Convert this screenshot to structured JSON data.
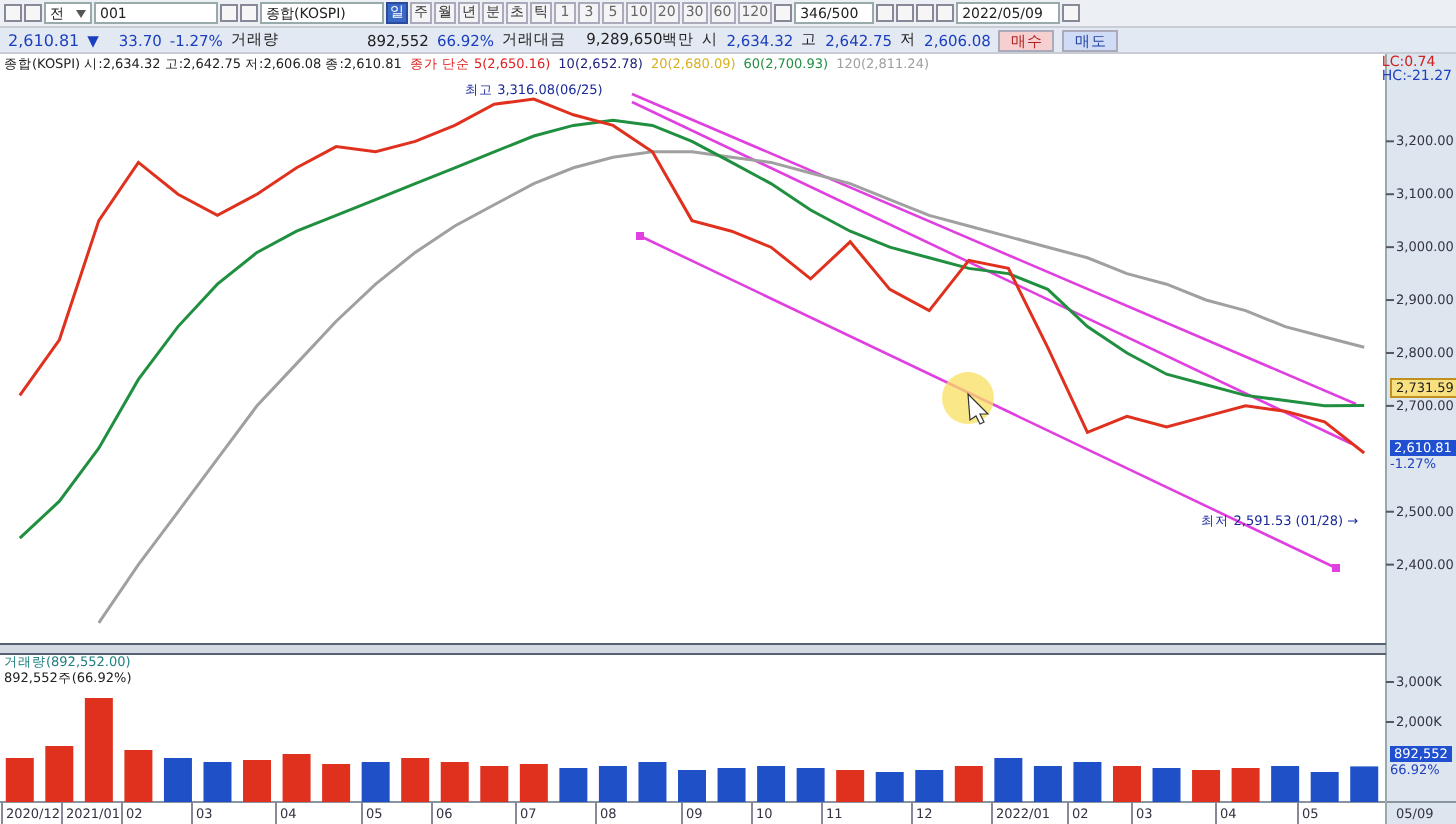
{
  "toolbar": {
    "market_combo": "전",
    "code_field": "001",
    "name_field": "종합(KOSPI)",
    "periods": [
      {
        "label": "일",
        "selected": true
      },
      {
        "label": "주",
        "selected": false
      },
      {
        "label": "월",
        "selected": false
      },
      {
        "label": "년",
        "selected": false
      },
      {
        "label": "분",
        "selected": false
      },
      {
        "label": "초",
        "selected": false
      },
      {
        "label": "틱",
        "selected": false
      }
    ],
    "intervals": [
      "1",
      "3",
      "5",
      "10",
      "20",
      "30",
      "60",
      "120"
    ],
    "count_field": "346/500",
    "date_field": "2022/05/09"
  },
  "quote": {
    "price": "2,610.81",
    "direction": "▼",
    "change": "33.70",
    "rate": "-1.27%",
    "volume_label": "거래량",
    "volume": "892,552",
    "volume_rate": "66.92%",
    "amount_label": "거래대금",
    "amount": "9,289,650백만",
    "open_label": "시",
    "open": "2,634.32",
    "high_label": "고",
    "high": "2,642.75",
    "low_label": "저",
    "low": "2,606.08",
    "buy_button": "매수",
    "sell_button": "매도"
  },
  "price_panel": {
    "legend_title": "종합(KOSPI) 시:2,634.32 고:2,642.75 저:2,606.08 종:2,610.81",
    "ma_legend": [
      {
        "label": "종가 단순 5(2,650.16)",
        "color": "#e02020"
      },
      {
        "label": "10(2,652.78)",
        "color": "#202080"
      },
      {
        "label": "20(2,680.09)",
        "color": "#d8b020"
      },
      {
        "label": "60(2,700.93)",
        "color": "#209040"
      },
      {
        "label": "120(2,811.24)",
        "color": "#a0a0a0"
      }
    ],
    "lc": "LC:0.74",
    "hc": "HC:-21.27",
    "ma20_badge": "2,731.59",
    "price_badge": "2,610.81",
    "rate_badge": "-1.27%",
    "chart_data": {
      "type": "line",
      "categories": [
        null,
        null,
        null,
        null,
        null,
        null,
        null,
        null,
        null,
        null,
        null,
        null,
        null,
        null,
        null,
        null,
        null,
        null,
        null,
        null,
        null,
        null,
        null,
        null,
        null,
        null,
        null,
        null,
        null,
        null,
        null,
        null,
        null,
        null,
        null
      ],
      "series": [
        {
          "color": "#e0301e",
          "values": [
            2720,
            2825,
            3050,
            3160,
            3100,
            3060,
            3100,
            3150,
            3190,
            3180,
            3200,
            3230,
            3270,
            3280,
            3250,
            3230,
            3180,
            3050,
            3030,
            3000,
            2940,
            3010,
            2920,
            2880,
            2975,
            2960,
            2810,
            2650,
            2680,
            2660,
            2680,
            2700,
            2690,
            2670,
            2611
          ]
        },
        {
          "color": "#209040",
          "values": [
            2450,
            2520,
            2620,
            2750,
            2850,
            2930,
            2990,
            3030,
            3060,
            3090,
            3120,
            3150,
            3180,
            3210,
            3230,
            3240,
            3230,
            3200,
            3160,
            3120,
            3070,
            3030,
            3000,
            2980,
            2960,
            2950,
            2920,
            2850,
            2800,
            2760,
            2740,
            2720,
            2710,
            2700,
            2701
          ]
        },
        {
          "color": "#a0a0a0",
          "values": [
            null,
            null,
            2290,
            2400,
            2500,
            2600,
            2700,
            2780,
            2860,
            2930,
            2990,
            3040,
            3080,
            3120,
            3150,
            3170,
            3180,
            3180,
            3170,
            3160,
            3140,
            3120,
            3090,
            3060,
            3040,
            3020,
            3000,
            2980,
            2950,
            2930,
            2900,
            2880,
            2850,
            2830,
            2811
          ]
        }
      ],
      "ylim": [
        2250,
        3365
      ],
      "yticks": [
        {
          "value": 2400,
          "label": "2,400.00"
        },
        {
          "value": 2500,
          "label": "2,500.00"
        },
        {
          "value": 2700,
          "label": "2,700.00"
        },
        {
          "value": 2800,
          "label": "2,800.00"
        },
        {
          "value": 2900,
          "label": "2,900.00"
        },
        {
          "value": 3000,
          "label": "3,000.00"
        },
        {
          "value": 3100,
          "label": "3,100.00"
        },
        {
          "value": 3200,
          "label": "3,200.00"
        }
      ],
      "annotations": [
        "최고 3,316.08(06/25)",
        "최저 2,591.53 (01/28) →"
      ]
    }
  },
  "volume_panel": {
    "legend_title": "거래량(892,552.00)",
    "legend_value": "892,552주(66.92%)",
    "volume_badge": "892,552",
    "rate_badge": "66.92%",
    "chart_data": {
      "type": "bar",
      "categories": [
        null,
        null,
        null,
        null,
        null,
        null,
        null,
        null,
        null,
        null,
        null,
        null,
        null,
        null,
        null,
        null,
        null,
        null,
        null,
        null,
        null,
        null,
        null,
        null,
        null,
        null,
        null,
        null,
        null,
        null,
        null,
        null,
        null,
        null,
        null
      ],
      "ylim": [
        0,
        3700
      ],
      "series": [
        {
          "color": "#e0301e",
          "values": [
            1100,
            1400,
            2600,
            1300,
            null,
            null,
            1050,
            1200,
            950,
            null,
            1100,
            1000,
            900,
            950,
            null,
            null,
            null,
            null,
            null,
            null,
            null,
            800,
            null,
            null,
            900,
            null,
            null,
            null,
            900,
            null,
            800,
            850,
            null,
            null,
            null
          ]
        },
        {
          "color": "#2050c8",
          "values": [
            null,
            null,
            null,
            null,
            1100,
            1000,
            null,
            null,
            null,
            1000,
            null,
            null,
            null,
            null,
            850,
            900,
            1000,
            800,
            850,
            900,
            850,
            null,
            750,
            800,
            null,
            1100,
            900,
            1000,
            null,
            850,
            null,
            null,
            900,
            750,
            890
          ]
        }
      ],
      "yticks": [
        {
          "value": 2000,
          "label": "2,000K"
        },
        {
          "value": 3000,
          "label": "3,000K"
        }
      ]
    }
  },
  "date_axis": {
    "labels": [
      "2020/12",
      "2021/01",
      "02",
      "03",
      "04",
      "05",
      "06",
      "07",
      "08",
      "09",
      "10",
      "11",
      "12",
      "2022/01",
      "02",
      "03",
      "04",
      "05"
    ],
    "last_date": "05/09"
  }
}
